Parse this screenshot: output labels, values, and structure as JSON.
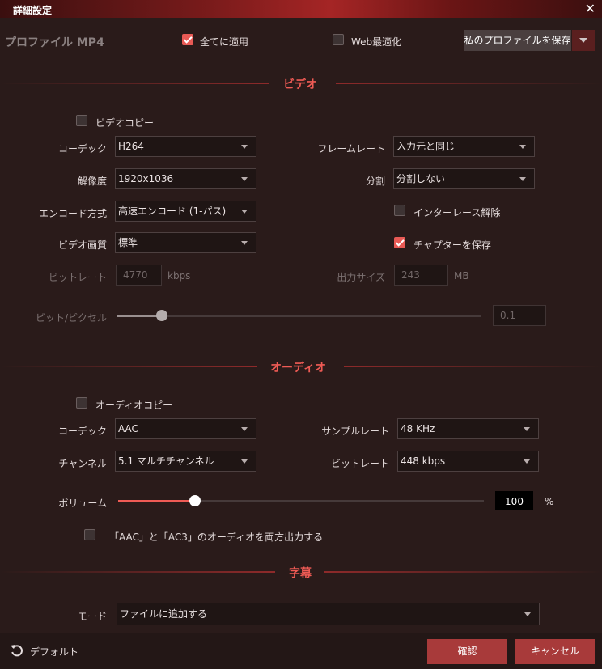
{
  "window": {
    "title": "詳細設定"
  },
  "profile": {
    "label": "プロファイル MP4",
    "apply_all": "全てに適用",
    "web_opt": "Web最適化",
    "save_profile": "私のプロファイルを保存"
  },
  "video": {
    "section": "ビデオ",
    "copy": "ビデオコピー",
    "codec_label": "コーデック",
    "codec": "H264",
    "resolution_label": "解像度",
    "resolution": "1920x1036",
    "encode_label": "エンコード方式",
    "encode": "高速エンコード (1-パス)",
    "quality_label": "ビデオ画質",
    "quality": "標準",
    "bitrate_label": "ビットレート",
    "bitrate": "4770",
    "bitrate_unit": "kbps",
    "framerate_label": "フレームレート",
    "framerate": "入力元と同じ",
    "split_label": "分割",
    "split": "分割しない",
    "deinterlace": "インターレース解除",
    "keep_chapters": "チャプターを保存",
    "output_size_label": "出力サイズ",
    "output_size": "243",
    "output_size_unit": "MB",
    "bpp_label": "ビット/ピクセル",
    "bpp": "0.1",
    "bpp_level": 0.1
  },
  "audio": {
    "section": "オーディオ",
    "copy": "オーディオコピー",
    "codec_label": "コーデック",
    "codec": "AAC",
    "channels_label": "チャンネル",
    "channels": "5.1 マルチチャンネル",
    "samplerate_label": "サンプルレート",
    "samplerate": "48 KHz",
    "bitrate_label": "ビットレート",
    "bitrate": "448 kbps",
    "volume_label": "ボリューム",
    "volume": "100",
    "volume_unit": "%",
    "volume_level": 0.2,
    "dual_output": "「AAC」と「AC3」のオーディオを両方出力する"
  },
  "subtitle": {
    "section": "字幕",
    "mode_label": "モード",
    "mode": "ファイルに追加する"
  },
  "footer": {
    "default": "デフォルト",
    "ok": "確認",
    "cancel": "キャンセル"
  },
  "colors": {
    "accent": "#ef5b55",
    "background": "#2a1b1a",
    "button": "#a83a3a"
  }
}
